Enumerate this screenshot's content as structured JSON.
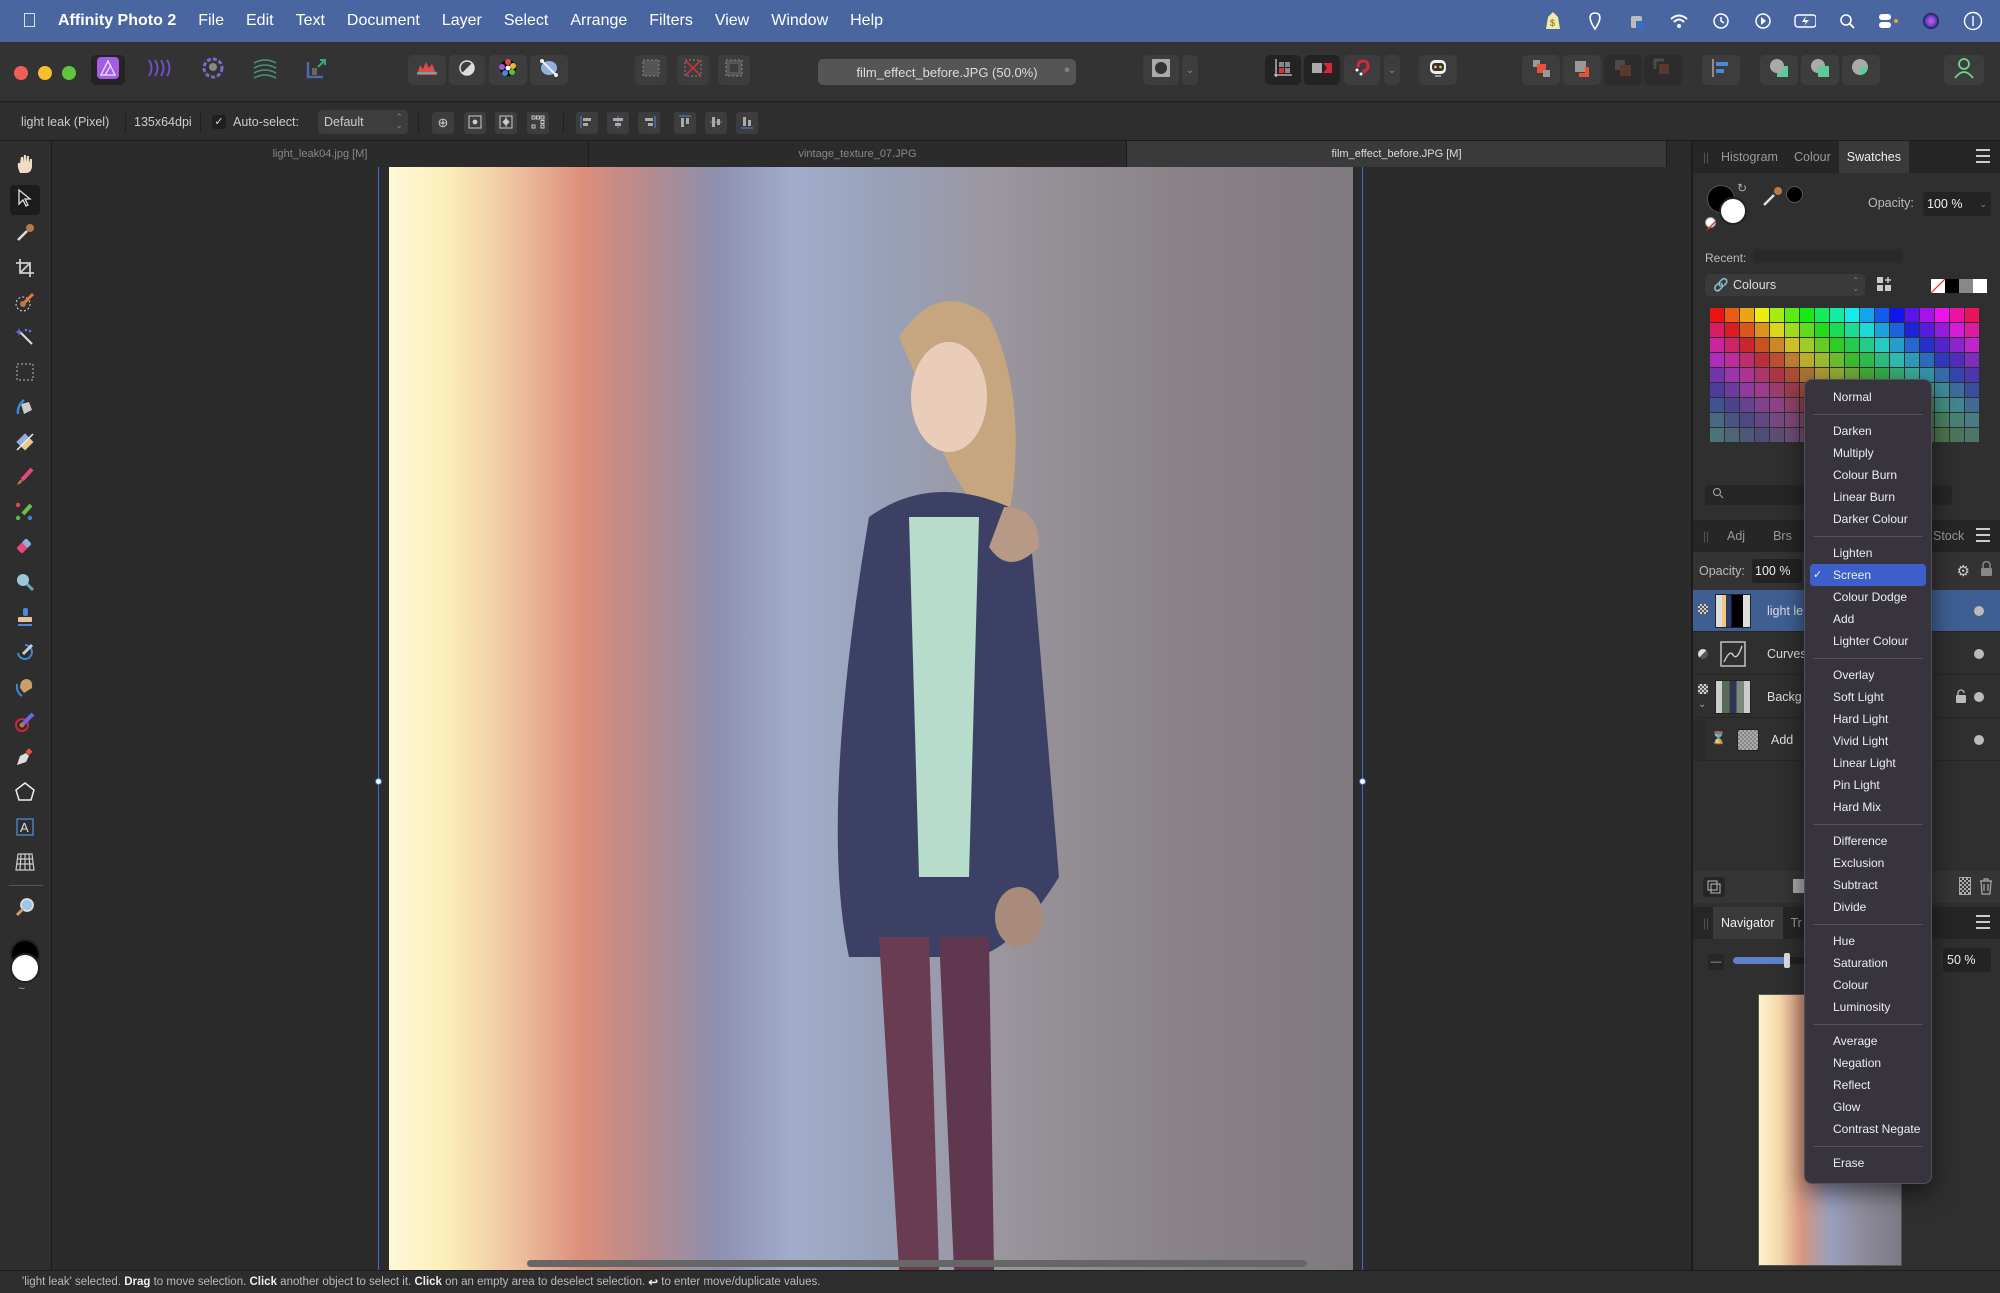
{
  "menubar": {
    "app_name": "Affinity Photo 2",
    "items": [
      "File",
      "Edit",
      "Text",
      "Document",
      "Layer",
      "Select",
      "Arrange",
      "Filters",
      "View",
      "Window",
      "Help"
    ],
    "tray_icons": [
      "dollar-icon",
      "location-shield-icon",
      "lock-camera-icon",
      "wifi-icon",
      "time-machine-icon",
      "play-circle-icon",
      "battery-charging-icon",
      "spotlight-search-icon",
      "control-center-icon",
      "siri-icon",
      "info-circle-icon"
    ]
  },
  "toolbar": {
    "personas": [
      "photo-persona",
      "liquify-persona",
      "develop-persona",
      "tone-mapping-persona",
      "export-persona"
    ],
    "document_title": "film_effect_before.JPG (50.0%)",
    "modified_marker": "*"
  },
  "context_bar": {
    "layer_label": "light leak (Pixel)",
    "dpi": "135x64dpi",
    "auto_select_checked": true,
    "auto_select_label": "Auto-select:",
    "auto_select_value": "Default"
  },
  "doc_tabs": [
    {
      "label": "light_leak04.jpg [M]",
      "active": false
    },
    {
      "label": "vintage_texture_07.JPG",
      "active": false
    },
    {
      "label": "film_effect_before.JPG [M]",
      "active": true
    }
  ],
  "tools": [
    "hand",
    "move",
    "colour-picker",
    "crop",
    "selection-brush",
    "flood-select",
    "marquee",
    "fill",
    "gradient",
    "paint-brush",
    "colour-replacement",
    "erase-brush",
    "dodge",
    "clone",
    "healing",
    "smudge",
    "paint-mixer",
    "pen",
    "shape",
    "text",
    "mesh-warp",
    "zoom"
  ],
  "swatches_panel": {
    "tabs": [
      "Histogram",
      "Colour",
      "Swatches"
    ],
    "active_tab": "Swatches",
    "opacity_label": "Opacity:",
    "opacity_value": "100 %",
    "recent_label": "Recent:",
    "palette_name": "Colours"
  },
  "layers_panel": {
    "tabs": [
      "Adj",
      "Brs",
      "Stock"
    ],
    "opacity_label": "Opacity:",
    "opacity_value": "100 %",
    "layers": [
      {
        "name": "light le",
        "selected": true,
        "type": "pixel"
      },
      {
        "name": "Curves",
        "selected": false,
        "type": "adjustment"
      },
      {
        "name": "Backg",
        "selected": false,
        "type": "pixel",
        "locked": true
      },
      {
        "name": "Add",
        "selected": false,
        "type": "fill"
      }
    ]
  },
  "navigator_panel": {
    "tabs": [
      "Navigator",
      "Tr"
    ],
    "zoom_value": "50 %",
    "zoom_fraction": 0.5
  },
  "blend_mode_menu": {
    "selected": "Screen",
    "groups": [
      [
        "Normal"
      ],
      [
        "Darken",
        "Multiply",
        "Colour Burn",
        "Linear Burn",
        "Darker Colour"
      ],
      [
        "Lighten",
        "Screen",
        "Colour Dodge",
        "Add",
        "Lighter Colour"
      ],
      [
        "Overlay",
        "Soft Light",
        "Hard Light",
        "Vivid Light",
        "Linear Light",
        "Pin Light",
        "Hard Mix"
      ],
      [
        "Difference",
        "Exclusion",
        "Subtract",
        "Divide"
      ],
      [
        "Hue",
        "Saturation",
        "Colour",
        "Luminosity"
      ],
      [
        "Average",
        "Negation",
        "Reflect",
        "Glow",
        "Contrast Negate"
      ],
      [
        "Erase"
      ]
    ]
  },
  "status_bar": {
    "parts": [
      {
        "text": "'light leak' selected. ",
        "bold": false
      },
      {
        "text": "Drag",
        "bold": true
      },
      {
        "text": " to move selection. ",
        "bold": false
      },
      {
        "text": "Click",
        "bold": true
      },
      {
        "text": " another object to select it. ",
        "bold": false
      },
      {
        "text": "Click",
        "bold": true
      },
      {
        "text": " on an empty area to deselect selection. ",
        "bold": false
      },
      {
        "text": "↩",
        "bold": true
      },
      {
        "text": " to enter move/duplicate values.",
        "bold": false
      }
    ]
  },
  "colors": {
    "menubar_bg": "#4a66a0",
    "selection_blue": "#3d5fc9",
    "layer_selected": "#3f5f93",
    "accent_green": "#6fd68c"
  }
}
